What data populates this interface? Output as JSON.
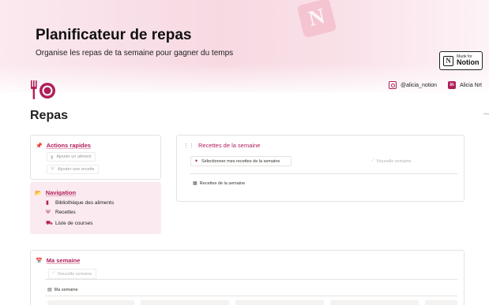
{
  "header": {
    "title": "Planificateur de repas",
    "subtitle": "Organise les repas de ta semaine pour gagner du temps",
    "badge_small": "Made for",
    "badge_big": "Notion",
    "badge_letter": "N",
    "banner_letter": "N"
  },
  "social": {
    "instagram": "@alicia_notion",
    "linkedin_icon": "in",
    "linkedin": "Alicia Nrt"
  },
  "page": {
    "heading": "Repas",
    "icon": "plate-cutlery-icon"
  },
  "quick_actions": {
    "title": "Actions rapides",
    "buttons": [
      {
        "label": "Ajouter un aliment",
        "icon": "food-icon"
      },
      {
        "label": "Ajouter une recette",
        "icon": "cutlery-icon"
      }
    ]
  },
  "navigation": {
    "title": "Navigation",
    "items": [
      {
        "label": "Bibliothèque des aliments",
        "icon": "book-icon"
      },
      {
        "label": "Recettes",
        "icon": "cutlery-icon"
      },
      {
        "label": "Liste de courses",
        "icon": "cart-icon"
      }
    ]
  },
  "weekly_recipes": {
    "title": "Recettes de la semaine",
    "select_button": "Sélectionner mes recettes de la semaine",
    "new_week": "Nouvelle semaine",
    "view_label": "Recettes de la semaine"
  },
  "my_week": {
    "title": "Ma semaine",
    "new_week": "Nouvelle semaine",
    "view_label": "Ma semaine"
  },
  "colors": {
    "accent": "#b01e5a",
    "nav_bg": "#fbeaf0",
    "banner": "#f7d9e2"
  }
}
